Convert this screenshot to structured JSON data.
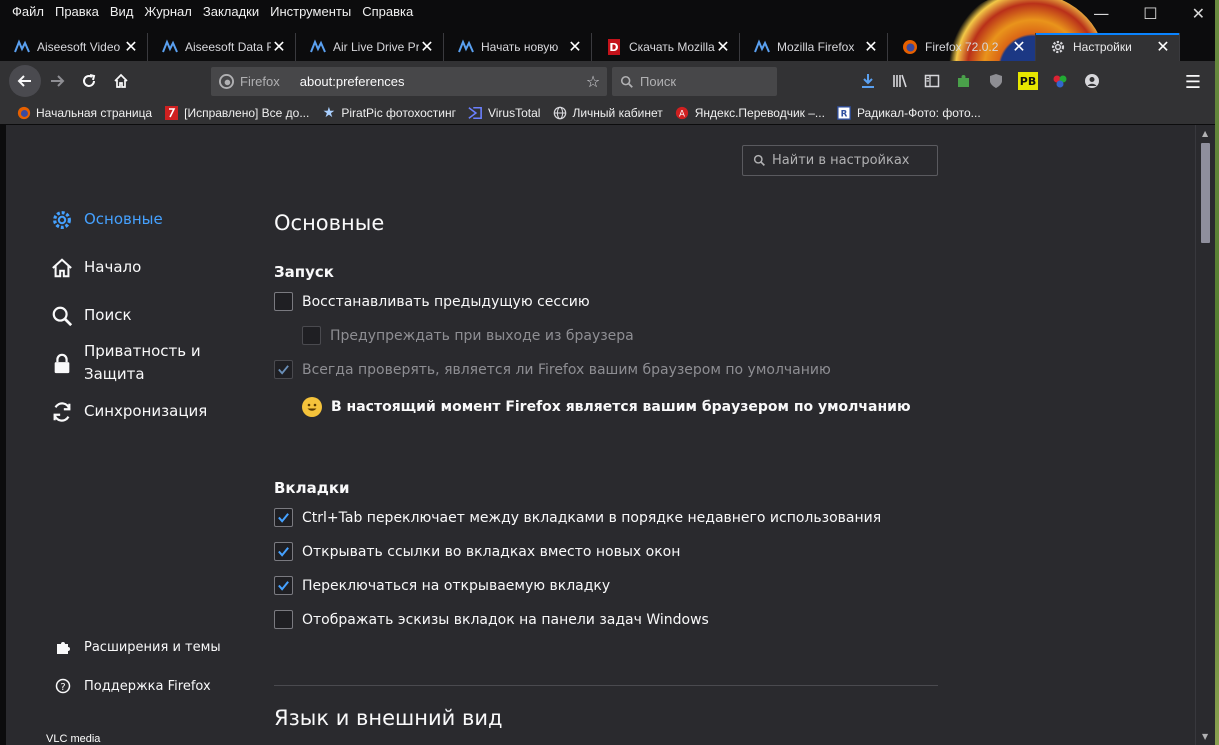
{
  "menubar": [
    "Файл",
    "Правка",
    "Вид",
    "Журнал",
    "Закладки",
    "Инструменты",
    "Справка"
  ],
  "tabs": [
    {
      "label": "Aiseesoft Video",
      "icon": "aiseesoft-icon",
      "active": false
    },
    {
      "label": "Aiseesoft Data R",
      "icon": "aiseesoft-icon",
      "active": false
    },
    {
      "label": "Air Live Drive Pr",
      "icon": "aiseesoft-icon",
      "active": false
    },
    {
      "label": "Начать новую",
      "icon": "aiseesoft-icon",
      "active": false
    },
    {
      "label": "Скачать Mozilla",
      "icon": "red-d-icon",
      "active": false
    },
    {
      "label": "Mozilla Firefox",
      "icon": "aiseesoft-icon",
      "active": false
    },
    {
      "label": "Firefox 72.0.2",
      "icon": "firefox-icon",
      "active": false
    },
    {
      "label": "Настройки",
      "icon": "gear-icon",
      "active": true
    }
  ],
  "urlbar": {
    "identity": "Firefox",
    "url": "about:preferences"
  },
  "searchbar": {
    "placeholder": "Поиск"
  },
  "bookmarks": [
    {
      "label": "Начальная страница",
      "icon": "firefox-icon"
    },
    {
      "label": "[Исправлено] Все до...",
      "icon": "red-square-icon"
    },
    {
      "label": "PiratPic фотохостинг",
      "icon": "star-icon"
    },
    {
      "label": "VirusTotal",
      "icon": "virustotal-icon"
    },
    {
      "label": "Личный кабинет",
      "icon": "globe-icon"
    },
    {
      "label": "Яндекс.Переводчик –...",
      "icon": "yandex-translate-icon"
    },
    {
      "label": "Радикал-Фото: фото...",
      "icon": "radikal-icon"
    }
  ],
  "prefs": {
    "search_placeholder": "Найти в настройках",
    "categories": [
      {
        "label": "Основные",
        "icon": "gear-icon",
        "selected": true
      },
      {
        "label": "Начало",
        "icon": "home-icon",
        "selected": false
      },
      {
        "label": "Поиск",
        "icon": "search-icon",
        "selected": false
      },
      {
        "label": "Приватность и Защита",
        "icon": "lock-icon",
        "selected": false
      },
      {
        "label": "Синхронизация",
        "icon": "sync-icon",
        "selected": false
      }
    ],
    "footer": {
      "extensions": "Расширения и темы",
      "support": "Поддержка Firefox"
    },
    "title": "Основные",
    "startup": {
      "heading": "Запуск",
      "restore_session": "Восстанавливать предыдущую сессию",
      "warn_on_quit": "Предупреждать при выходе из браузера",
      "check_default": "Всегда проверять, является ли Firefox вашим браузером по умолчанию",
      "is_default": "В настоящий момент Firefox является вашим браузером по умолчанию"
    },
    "tabs_section": {
      "heading": "Вкладки",
      "ctrl_tab": "Ctrl+Tab переключает между вкладками в порядке недавнего использования",
      "open_links": "Открывать ссылки во вкладках вместо новых окон",
      "switch_to_new": "Переключаться на открываемую вкладку",
      "taskbar_previews": "Отображать эскизы вкладок на панели задач Windows"
    },
    "next_title": "Язык и внешний вид"
  },
  "desktop": {
    "bottom_label": "VLC media"
  },
  "colors": {
    "accent": "#0a84ff",
    "selected_text": "#45a1ff",
    "content_bg": "#2a2a2e",
    "toolbar_bg": "#323234"
  }
}
